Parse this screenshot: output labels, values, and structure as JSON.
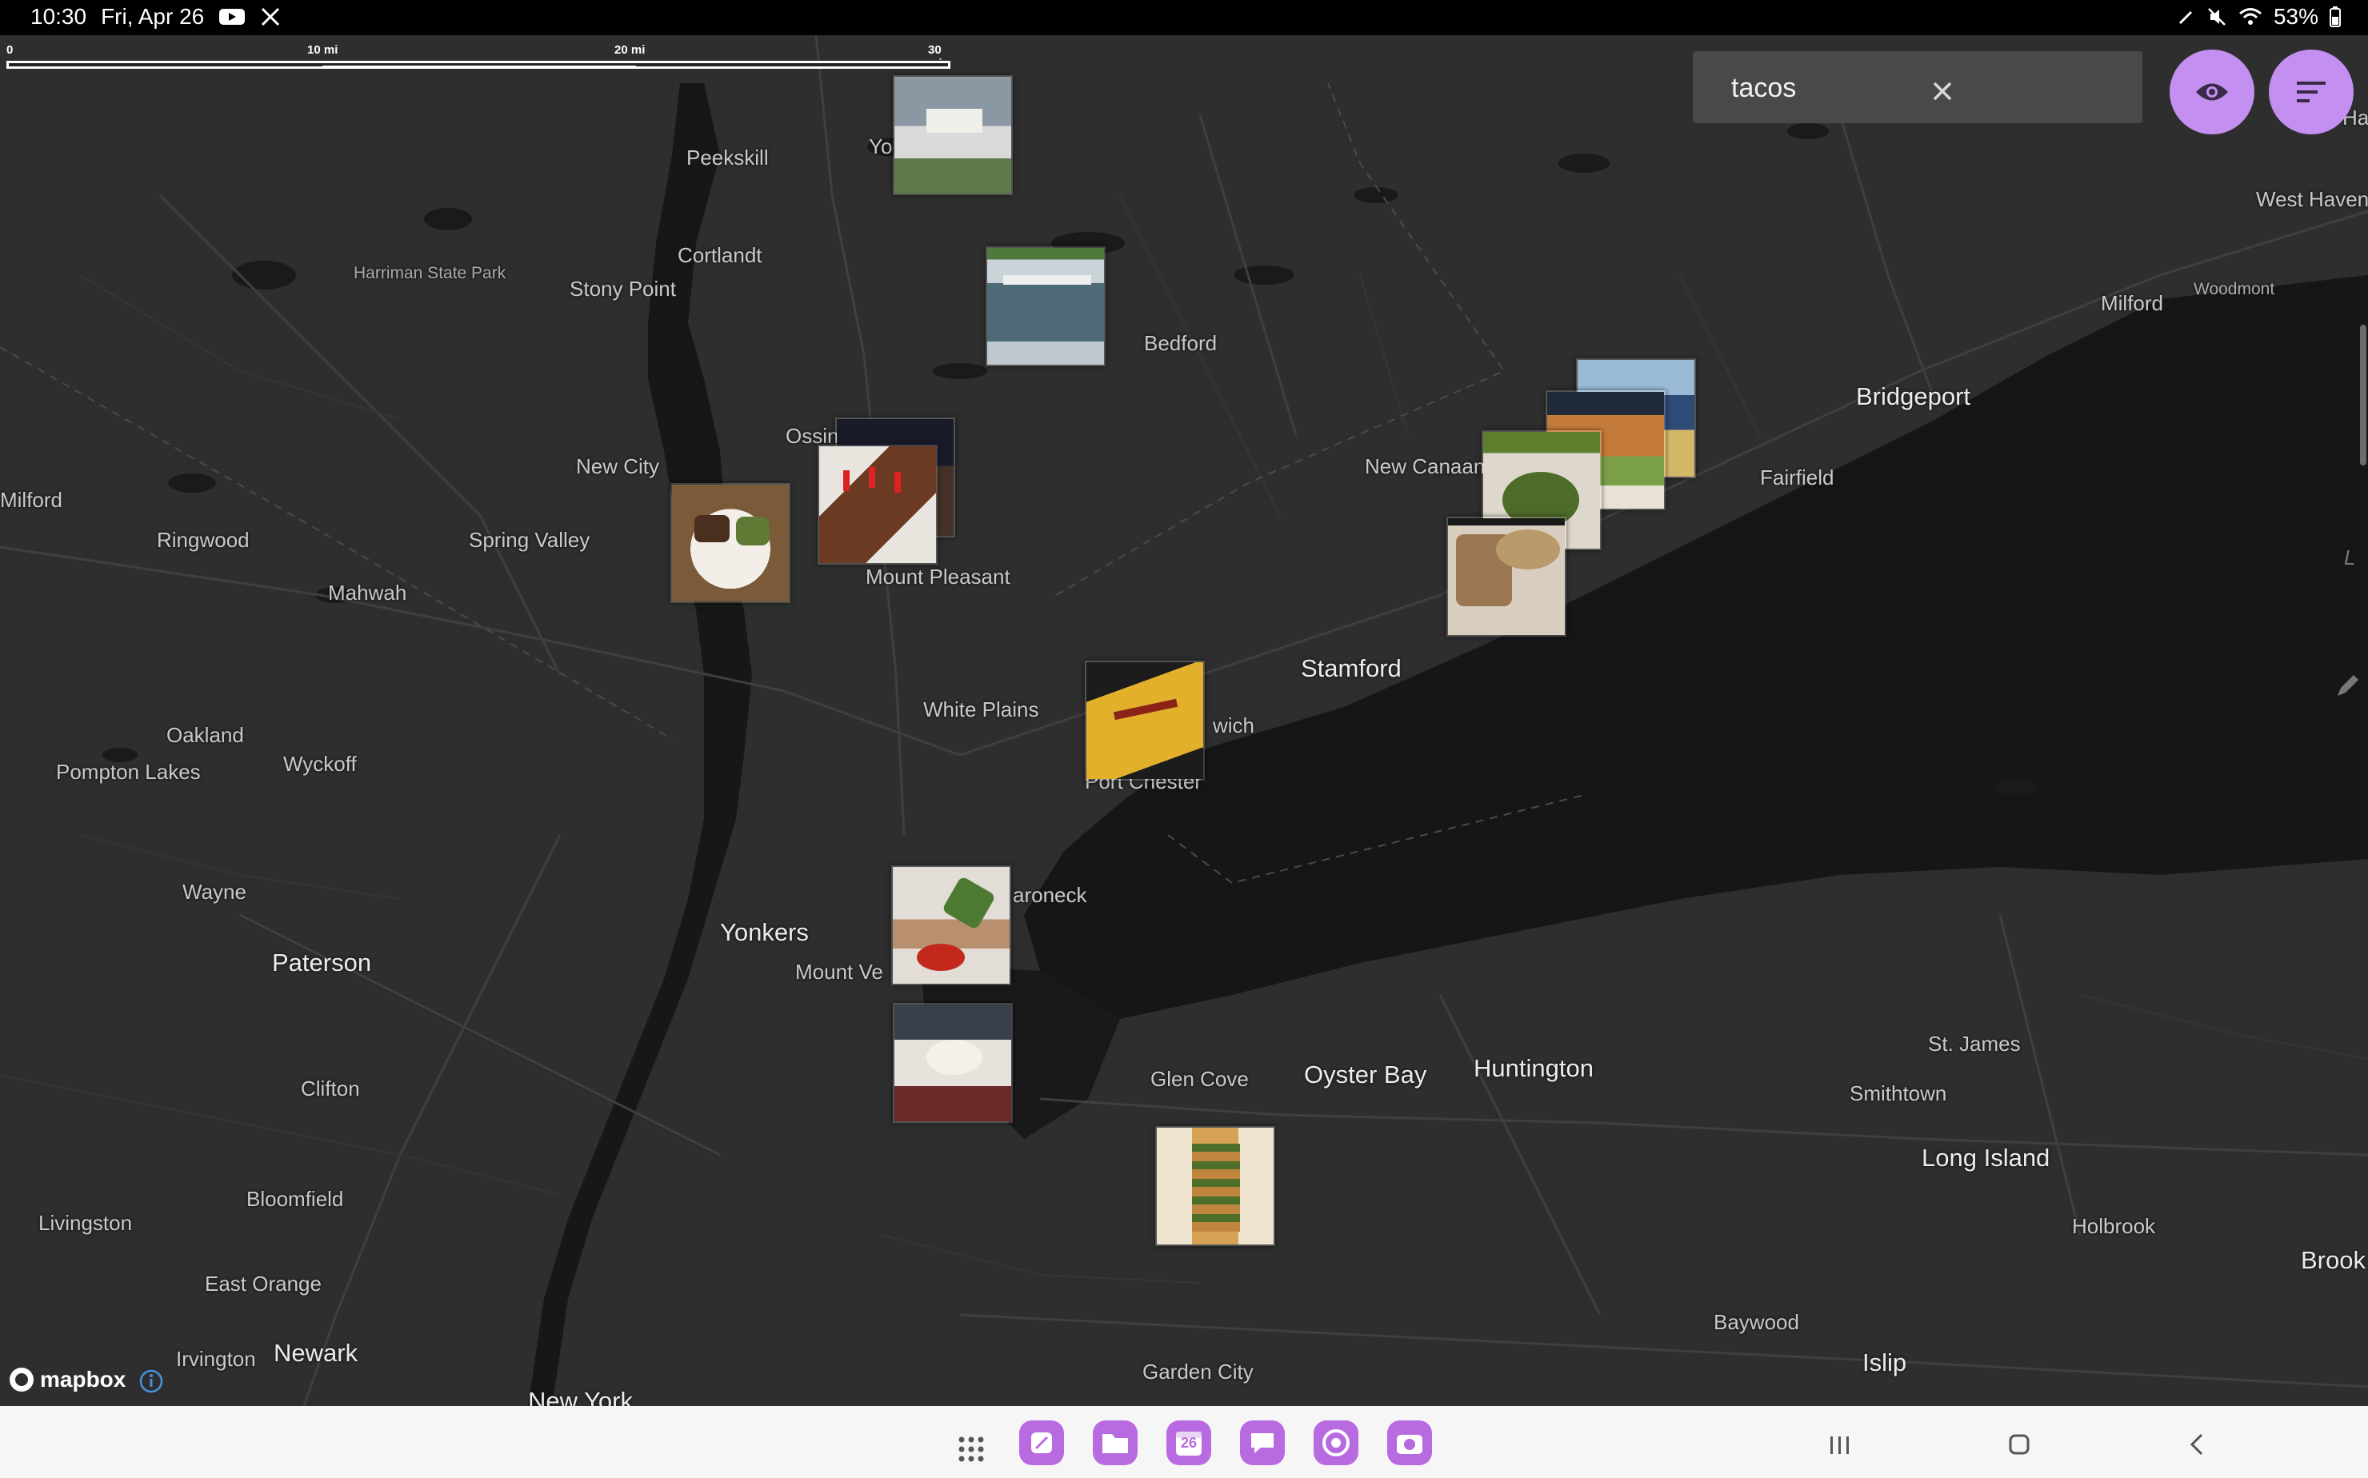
{
  "status_bar": {
    "time": "10:30",
    "date": "Fri, Apr 26",
    "battery": "53%"
  },
  "scale_bar": {
    "labels": [
      "0",
      "10 mi",
      "20 mi",
      "30 mi"
    ]
  },
  "search": {
    "value": "tacos"
  },
  "buttons": {
    "visibility": "eye-icon",
    "sort": "sort-icon"
  },
  "attribution": {
    "logo": "mapbox"
  },
  "places": {
    "peekskill": "Peekskill",
    "yo": "Yo",
    "cortlandt": "Cortlandt",
    "harriman": "Harriman State Park",
    "stony_point": "Stony Point",
    "bedford": "Bedford",
    "ossin": "Ossin",
    "new_city": "New City",
    "milford_left": "Milford",
    "ringwood": "Ringwood",
    "spring_valley": "Spring Valley",
    "mahwah": "Mahwah",
    "mount_pleasant": "Mount Pleasant",
    "white_plains": "White Plains",
    "wich": "wich",
    "port_chester": "Port Chester",
    "stamford": "Stamford",
    "new_canaan": "New Canaan",
    "fairfield": "Fairfield",
    "bridgeport": "Bridgeport",
    "milford_right": "Milford",
    "woodmont": "Woodmont",
    "west_haven": "West Haven",
    "ha": "Ha",
    "oakland": "Oakland",
    "wyckoff": "Wyckoff",
    "pompton_lakes": "Pompton Lakes",
    "wayne": "Wayne",
    "paterson": "Paterson",
    "yonkers": "Yonkers",
    "mount_vernon": "Mount Ve",
    "mamaroneck": "aroneck",
    "clifton": "Clifton",
    "glen_cove": "Glen Cove",
    "oyster_bay": "Oyster Bay",
    "huntington": "Huntington",
    "st_james": "St. James",
    "smithtown": "Smithtown",
    "long_island": "Long Island",
    "holbrook": "Holbrook",
    "brook": "Brook",
    "bloomfield": "Bloomfield",
    "livingston": "Livingston",
    "east_orange": "East Orange",
    "irvington": "Irvington",
    "newark": "Newark",
    "new_york": "New York",
    "garden_city": "Garden City",
    "baywood": "Baywood",
    "islip": "Islip",
    "l_edge": "L"
  },
  "photo_markers": [
    {
      "name": "photo-marker-yorktown",
      "palette": [
        "#8d9aa6",
        "#5c7a4a",
        "#dcdcdc"
      ]
    },
    {
      "name": "photo-marker-bedford-storefront",
      "palette": [
        "#6b8fa0",
        "#3d5560",
        "#c7d4da"
      ]
    },
    {
      "name": "photo-marker-ossining-dessert",
      "palette": [
        "#3a2a1e",
        "#6b4028",
        "#d9d0c7"
      ]
    },
    {
      "name": "photo-marker-new-city-plate",
      "palette": [
        "#c9a27a",
        "#5a6e2e",
        "#f1ede6"
      ]
    },
    {
      "name": "photo-marker-port-chester-sign",
      "palette": [
        "#e3b12c",
        "#7a2a1a",
        "#1a1a1a"
      ]
    },
    {
      "name": "photo-marker-cluster-norwalk-1",
      "palette": [
        "#7aa2c8",
        "#c9b16a",
        "#3a4f70"
      ]
    },
    {
      "name": "photo-marker-cluster-norwalk-2",
      "palette": [
        "#c77d3c",
        "#6b8e3e",
        "#e8e2d8"
      ]
    },
    {
      "name": "photo-marker-cluster-norwalk-3",
      "palette": [
        "#4e6b2a",
        "#8d7a5a",
        "#dcd7cf"
      ]
    },
    {
      "name": "photo-marker-cluster-norwalk-4",
      "palette": [
        "#9a7752",
        "#5c6f73",
        "#d8cdbf"
      ]
    },
    {
      "name": "photo-marker-mamaroneck-tacos",
      "palette": [
        "#c34a3a",
        "#d9c7a8",
        "#5a7a3a"
      ]
    },
    {
      "name": "photo-marker-new-rochelle-dish",
      "palette": [
        "#8a2a2a",
        "#e6e0da",
        "#3a5a3a"
      ]
    },
    {
      "name": "photo-marker-glen-cove-tacos",
      "palette": [
        "#d8a657",
        "#4e6f2a",
        "#efe4cf"
      ]
    }
  ],
  "dock_apps": [
    "notes",
    "files",
    "calendar",
    "messages",
    "browser",
    "camera"
  ],
  "calendar_day": "26"
}
